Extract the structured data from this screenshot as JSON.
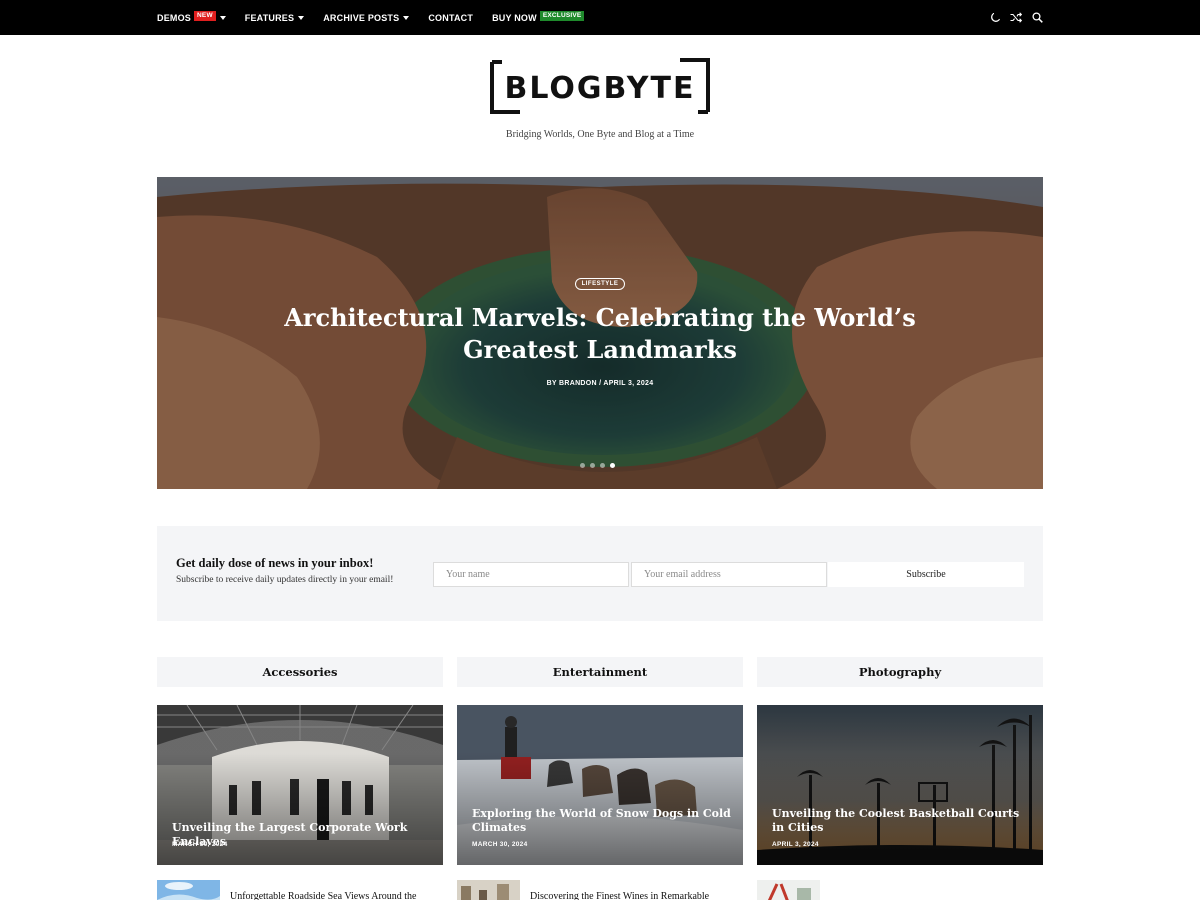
{
  "nav": {
    "items": [
      {
        "label": "DEMOS",
        "badge": "NEW",
        "caret": true
      },
      {
        "label": "FEATURES",
        "caret": true
      },
      {
        "label": "ARCHIVE POSTS",
        "caret": true
      },
      {
        "label": "CONTACT"
      },
      {
        "label": "BUY NOW",
        "badge": "EXCLUSIVE"
      }
    ],
    "icons": [
      "moon-icon",
      "shuffle-icon",
      "search-icon"
    ]
  },
  "brand": {
    "logo_text": "BLOGBYTE",
    "tagline": "Bridging Worlds, One Byte and Blog at a Time"
  },
  "hero": {
    "category": "LIFESTYLE",
    "title": "Architectural Marvels: Celebrating the World’s Greatest Landmarks",
    "meta": "BY  BRANDON  /  APRIL 3, 2024",
    "slides_total": 4,
    "active_slide": 4
  },
  "newsletter": {
    "title": "Get daily dose of news in your inbox!",
    "subtitle": "Subscribe to receive daily updates directly in your email!",
    "name_placeholder": "Your name",
    "email_placeholder": "Your email address",
    "button": "Subscribe"
  },
  "columns": [
    {
      "heading": "Accessories",
      "card": {
        "title": "Unveiling the Largest Corporate Work Enclaves",
        "date": "MARCH 30, 2024"
      },
      "mini": {
        "title": "Unforgettable Roadside Sea Views Around the"
      }
    },
    {
      "heading": "Entertainment",
      "card": {
        "title": "Exploring the World of Snow Dogs in Cold Climates",
        "date": "MARCH 30, 2024"
      },
      "mini": {
        "title": "Discovering the Finest Wines in Remarkable"
      }
    },
    {
      "heading": "Photography",
      "card": {
        "title": "Unveiling the Coolest Basketball Courts in Cities",
        "date": "APRIL 3, 2024"
      },
      "mini": {
        "title": ""
      }
    }
  ],
  "colors": {
    "topbar": "#000000",
    "badge_new": "#e01f1f",
    "badge_exclusive": "#1f8a2c",
    "panel_bg": "#f4f5f7"
  }
}
